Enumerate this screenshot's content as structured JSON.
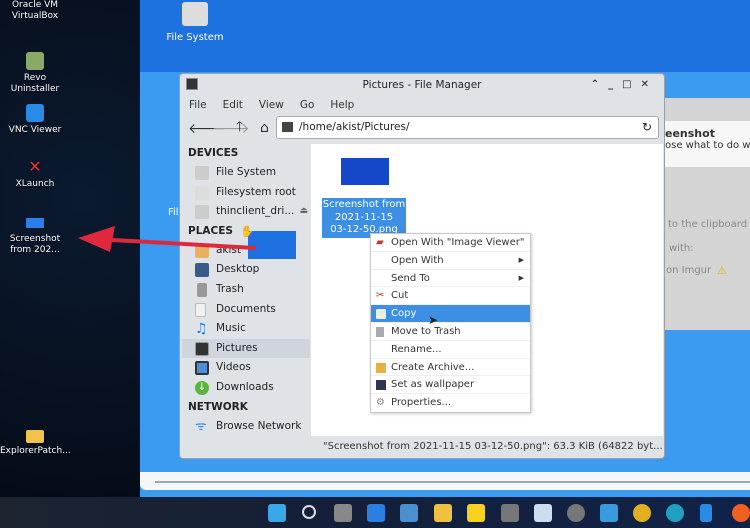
{
  "windows_desktop": {
    "icons": [
      {
        "label": "Oracle VM VirtualBox",
        "icon": "virtualbox-icon"
      },
      {
        "label": "Revo Uninstaller",
        "icon": "revo-icon"
      },
      {
        "label": "VNC Viewer",
        "icon": "vnc-icon"
      },
      {
        "label": "XLaunch",
        "icon": "xlaunch-icon"
      },
      {
        "label": "Screenshot from 202...",
        "icon": "image-file-icon"
      },
      {
        "label": "ExplorerPatch...",
        "icon": "folder-icon"
      }
    ]
  },
  "vm_desktop": {
    "file_system_label": "File System",
    "partial_label": "Fil"
  },
  "file_manager": {
    "title": "Pictures - File Manager",
    "menu": [
      "File",
      "Edit",
      "View",
      "Go",
      "Help"
    ],
    "path": "/home/akist/Pictures/",
    "sidebar": {
      "devices_header": "DEVICES",
      "devices": [
        "File System",
        "Filesystem root",
        "thinclient_dri..."
      ],
      "places_header": "PLACES",
      "places": [
        "akist",
        "Desktop",
        "Trash",
        "Documents",
        "Music",
        "Pictures",
        "Videos",
        "Downloads"
      ],
      "selected": "Pictures",
      "network_header": "NETWORK",
      "network": [
        "Browse Network"
      ]
    },
    "file": {
      "name": "Screenshot from 2021-11-15 03-12-50.png",
      "line1": "Screenshot from",
      "line2": "2021-11-15",
      "line3": "03-12-50.png"
    },
    "status": "\"Screenshot from 2021-11-15 03-12-50.png\": 63.3 KiB (64822 byt..."
  },
  "context_menu": {
    "items": [
      "Open With \"Image Viewer\"",
      "Open With",
      "Send To",
      "Cut",
      "Copy",
      "Move to Trash",
      "Rename...",
      "Create Archive...",
      "Set as wallpaper",
      "Properties..."
    ],
    "highlighted": "Copy"
  },
  "screenshot_dialog": {
    "title": "eenshot",
    "subtitle": "ose what to do wit",
    "opt1": "to the clipboard",
    "opt2": "with:",
    "opt3": "on Imgur"
  },
  "taskbar": {
    "icons": [
      "start-icon",
      "search-icon",
      "task-view-icon",
      "snap-icon",
      "control-panel-icon",
      "file-explorer-icon",
      "sticky-notes-icon",
      "calculator-icon",
      "resource-monitor-icon",
      "settings-icon",
      "remote-desktop-icon",
      "power-icon",
      "edge-icon",
      "phone-icon",
      "firefox-icon"
    ]
  },
  "colors": {
    "accent": "#3d8fe3",
    "vm_desktop": "#3b9bf0",
    "arrow": "#e0283c"
  }
}
